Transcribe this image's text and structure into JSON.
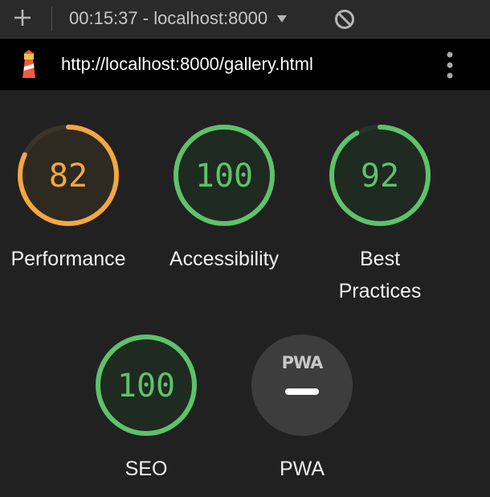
{
  "toolbar": {
    "session_label": "00:15:37 - localhost:8000"
  },
  "urlbar": {
    "url": "http://localhost:8000/gallery.html"
  },
  "colors": {
    "pass": "#5ec26b",
    "average": "#f4a742",
    "label": "#f0f0f0",
    "pwa_badge": "#3d3d3d"
  },
  "categories": [
    {
      "id": "performance",
      "label": "Performance",
      "score": "82",
      "fraction": 0.82,
      "rating": "average"
    },
    {
      "id": "accessibility",
      "label": "Accessibility",
      "score": "100",
      "fraction": 1.0,
      "rating": "pass"
    },
    {
      "id": "best-practices",
      "label_lines": [
        "Best",
        "Practices"
      ],
      "score": "92",
      "fraction": 0.92,
      "rating": "pass"
    },
    {
      "id": "seo",
      "label": "SEO",
      "score": "100",
      "fraction": 1.0,
      "rating": "pass"
    },
    {
      "id": "pwa",
      "label": "PWA",
      "badge_text": "PWA",
      "icon": "pwa-badge-icon"
    }
  ]
}
